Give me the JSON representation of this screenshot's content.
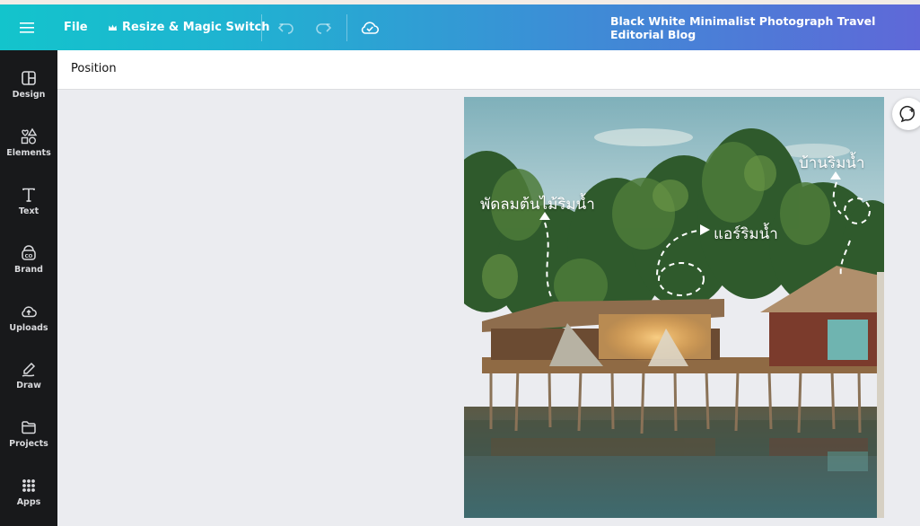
{
  "topbar": {
    "file_label": "File",
    "resize_label": "Resize & Magic Switch",
    "design_title": "Black White Minimalist Photograph Travel Editorial Blog",
    "icons": [
      "menu-icon",
      "crown-icon",
      "undo-icon",
      "redo-icon",
      "cloud-check-icon"
    ]
  },
  "sidebar": {
    "items": [
      {
        "label": "Design",
        "icon": "layout-icon"
      },
      {
        "label": "Elements",
        "icon": "shapes-icon"
      },
      {
        "label": "Text",
        "icon": "text-icon"
      },
      {
        "label": "Brand",
        "icon": "brand-icon"
      },
      {
        "label": "Uploads",
        "icon": "cloud-upload-icon"
      },
      {
        "label": "Draw",
        "icon": "pen-icon"
      },
      {
        "label": "Projects",
        "icon": "folder-icon"
      },
      {
        "label": "Apps",
        "icon": "apps-grid-icon"
      }
    ]
  },
  "context_bar": {
    "position_label": "Position"
  },
  "canvas": {
    "labels": {
      "fan": "พัดลมต้นไม้ริมน้ำ",
      "air": "แอร์ริมน้ำ",
      "house": "บ้านริมน้ำ"
    }
  },
  "colors": {
    "gradient_start": "#13c4cc",
    "gradient_end": "#5f68d8",
    "sidebar_bg": "#18191b",
    "canvas_bg": "#ebecf0"
  }
}
